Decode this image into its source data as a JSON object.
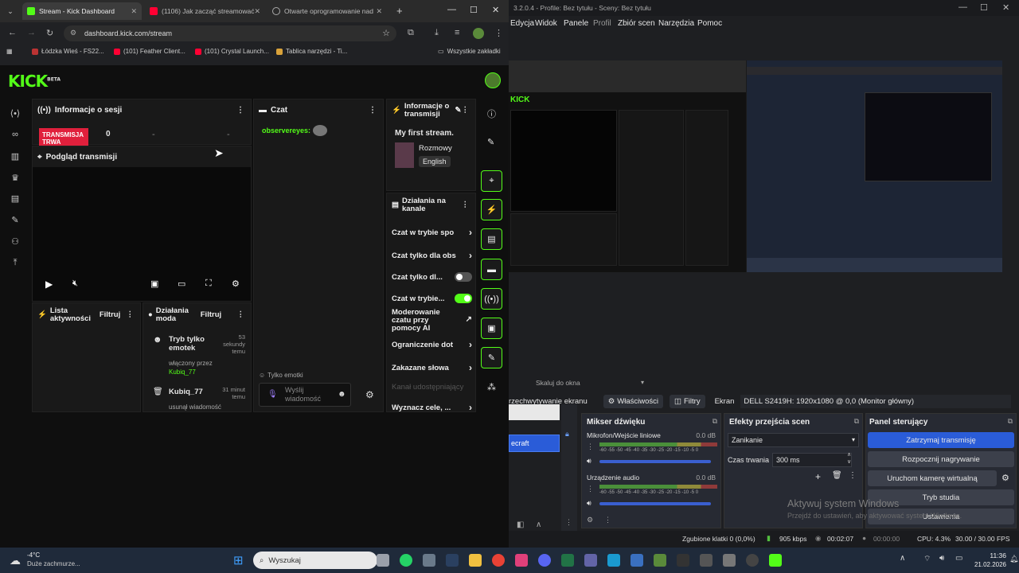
{
  "browser": {
    "tabs": [
      {
        "label": "Stream - Kick Dashboard",
        "color": "#53fc18"
      },
      {
        "label": "(1106) Jak zacząć streamować",
        "color": "#ff0033"
      },
      {
        "label": "Otwarte oprogramowanie nad",
        "color": "#888888"
      }
    ],
    "url": "dashboard.kick.com/stream",
    "bookmarks": [
      "Łódzka Wieś - FS22...",
      "(101) Feather Client...",
      "(101) Crystal Launch...",
      "Tablica narzędzi - Ti..."
    ],
    "all_bookmarks": "Wszystkie zakładki"
  },
  "kick": {
    "logo": "KICK",
    "logo_badge": "BETA",
    "session": {
      "title": "Informacje o sesji",
      "live_badge": "TRANSMISJA TRWA",
      "viewers": "0",
      "dash1": "-",
      "dash2": "-"
    },
    "preview": {
      "title": "Podgląd transmisji"
    },
    "activity": {
      "title": "Lista aktywności",
      "filter": "Filtruj"
    },
    "mod_actions": {
      "title": "Działania moda",
      "filter": "Filtruj",
      "items": [
        {
          "action": "Tryb tylko emotek",
          "time": "53 sekundy temu",
          "by_label": "włączony przez",
          "by_user": "Kubiq_77"
        },
        {
          "action": "Kubiq_77",
          "time": "31 minut temu",
          "sub": "usunął wiadomość"
        }
      ]
    },
    "chat": {
      "title": "Czat",
      "user": "observereyes:",
      "emotes_only": "Tylko emotki",
      "placeholder": "Wyślij wiadomość"
    },
    "stream_info": {
      "title": "Informacje o transmisji",
      "stream_title": "My first stream.",
      "category": "Rozmowy",
      "language": "English"
    },
    "channel_actions": {
      "title": "Działania na kanale",
      "items": [
        {
          "label": "Czat w trybie spo",
          "kind": "chevron"
        },
        {
          "label": "Czat tylko dla obs",
          "kind": "chevron"
        },
        {
          "label": "Czat tylko dl...",
          "kind": "toggle_off"
        },
        {
          "label": "Czat w trybie...",
          "kind": "toggle_on"
        },
        {
          "label": "Moderowanie czatu przy pomocy AI",
          "kind": "external"
        },
        {
          "label": "Ograniczenie dot",
          "kind": "chevron"
        },
        {
          "label": "Zakazane słowa",
          "kind": "chevron"
        },
        {
          "label": "Kanał udostępniający",
          "kind": "dim"
        },
        {
          "label": "Wyznacz cele, ...",
          "kind": "chevron"
        }
      ]
    }
  },
  "obs": {
    "title": "3.2.0.4 - Profile: Bez tytułu - Sceny: Bez tytułu",
    "menu": [
      "Edycja",
      "Widok",
      "Panele",
      "Profil",
      "Zbiór scen",
      "Narzędzia",
      "Pomoc"
    ],
    "source_bar": {
      "label": "Skaluj do okna",
      "capture": "rzechwytywanie ekranu",
      "properties": "Właściwości",
      "filters": "Filtry",
      "screen_label": "Ekran",
      "screen_value": "DELL S2419H: 1920x1080 @ 0,0 (Monitor główny)"
    },
    "scene_item": "ecraft",
    "mixer": {
      "title": "Mikser dźwięku",
      "tracks": [
        {
          "name": "Mikrofon/Wejście liniowe",
          "db": "0.0 dB"
        },
        {
          "name": "Urządzenie audio",
          "db": "0.0 dB"
        }
      ],
      "scale": "-60 -55 -50 -45 -40 -35 -30 -25 -20 -15 -10 -5 0"
    },
    "transitions": {
      "title": "Efekty przejścia scen",
      "selected": "Zanikanie",
      "duration_label": "Czas trwania",
      "duration": "300 ms"
    },
    "controls": {
      "title": "Panel sterujący",
      "buttons": [
        "Zatrzymaj transmisję",
        "Rozpocznij nagrywanie",
        "Uruchom kamerę wirtualną",
        "Tryb studia",
        "Ustawienia"
      ]
    },
    "status": {
      "dropped": "Zgubione klatki 0 (0,0%)",
      "bitrate": "905 kbps",
      "live_time": "00:02:07",
      "rec_time": "00:00:00",
      "cpu": "CPU: 4.3%",
      "fps": "30.00 / 30.00 FPS"
    },
    "watermark_title": "Aktywuj system Windows",
    "watermark_sub": "Przejdź do ustawień, aby aktywować system Windows."
  },
  "taskbar": {
    "temp": "-4°C",
    "weather": "Duże zachmurze...",
    "search": "Wyszukaj",
    "time": "11:36",
    "date": "21.02.2026"
  },
  "colors": {
    "kick_green": "#53fc18",
    "live_red": "#e0203c",
    "obs_blue": "#2a5cd8"
  }
}
